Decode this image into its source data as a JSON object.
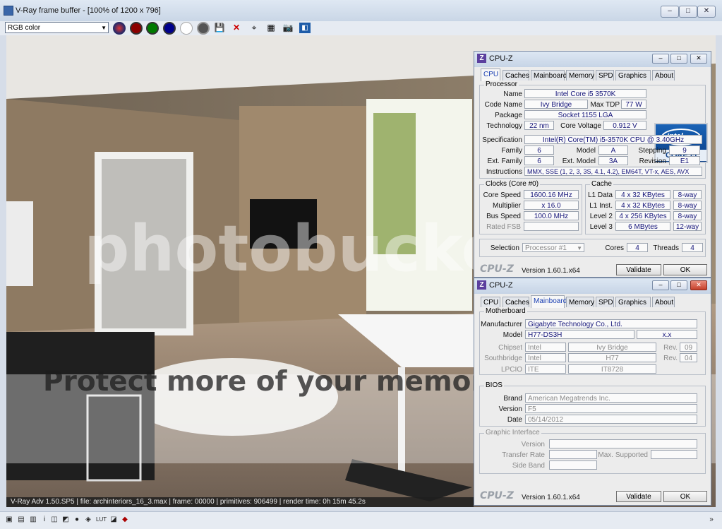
{
  "vray": {
    "title": "V-Ray frame buffer - [100% of 1200 x 796]",
    "channel": "RGB color",
    "status": "V-Ray Adv 1.50.SP5 | file: archinteriors_16_3.max | frame: 00000 | primitives: 906499 | render time: 0h 15m 45.2s",
    "watermark_top": "photobucket",
    "watermark_bottom": "Protect more of your memories for less!",
    "window_buttons": {
      "minimize": "–",
      "maximize": "□",
      "close": "✕"
    }
  },
  "cpuz1": {
    "title": "CPU-Z",
    "tabs": [
      "CPU",
      "Caches",
      "Mainboard",
      "Memory",
      "SPD",
      "Graphics",
      "About"
    ],
    "active_tab": "CPU",
    "processor": {
      "legend": "Processor",
      "name_label": "Name",
      "name": "Intel Core i5 3570K",
      "codename_label": "Code Name",
      "codename": "Ivy Bridge",
      "maxtdp_label": "Max TDP",
      "maxtdp": "77 W",
      "package_label": "Package",
      "package": "Socket 1155 LGA",
      "tech_label": "Technology",
      "tech": "22 nm",
      "voltage_label": "Core Voltage",
      "voltage": "0.912 V",
      "spec_label": "Specification",
      "spec": "Intel(R) Core(TM) i5-3570K CPU @ 3.40GHz",
      "family_label": "Family",
      "family": "6",
      "model_label": "Model",
      "model": "A",
      "stepping_label": "Stepping",
      "stepping": "9",
      "extfamily_label": "Ext. Family",
      "extfamily": "6",
      "extmodel_label": "Ext. Model",
      "extmodel": "3A",
      "revision_label": "Revision",
      "revision": "E1",
      "instr_label": "Instructions",
      "instr": "MMX, SSE (1, 2, 3, 3S, 4.1, 4.2), EM64T, VT-x, AES, AVX",
      "badge_top": "intel",
      "badge_sub": "inside",
      "badge_bottom": "CORE i5"
    },
    "clocks": {
      "legend": "Clocks (Core #0)",
      "speed_label": "Core Speed",
      "speed": "1600.16 MHz",
      "mult_label": "Multiplier",
      "mult": "x 16.0",
      "bus_label": "Bus Speed",
      "bus": "100.0 MHz",
      "fsb_label": "Rated FSB",
      "fsb": ""
    },
    "cache": {
      "legend": "Cache",
      "l1d_label": "L1 Data",
      "l1d": "4 x 32 KBytes",
      "l1d_way": "8-way",
      "l1i_label": "L1 Inst.",
      "l1i": "4 x 32 KBytes",
      "l1i_way": "8-way",
      "l2_label": "Level 2",
      "l2": "4 x 256 KBytes",
      "l2_way": "8-way",
      "l3_label": "Level 3",
      "l3": "6 MBytes",
      "l3_way": "12-way"
    },
    "selection_label": "Selection",
    "selection": "Processor #1",
    "cores_label": "Cores",
    "cores": "4",
    "threads_label": "Threads",
    "threads": "4",
    "brand": "CPU-Z",
    "version": "Version 1.60.1.x64",
    "validate": "Validate",
    "ok": "OK"
  },
  "cpuz2": {
    "title": "CPU-Z",
    "tabs": [
      "CPU",
      "Caches",
      "Mainboard",
      "Memory",
      "SPD",
      "Graphics",
      "About"
    ],
    "active_tab": "Mainboard",
    "motherboard": {
      "legend": "Motherboard",
      "manufacturer_label": "Manufacturer",
      "manufacturer": "Gigabyte Technology Co., Ltd.",
      "model_label": "Model",
      "model": "H77-DS3H",
      "model_rev": "x.x",
      "chipset_label": "Chipset",
      "chipset_vendor": "Intel",
      "chipset": "Ivy Bridge",
      "chipset_rev_label": "Rev.",
      "chipset_rev": "09",
      "south_label": "Southbridge",
      "south_vendor": "Intel",
      "south": "H77",
      "south_rev_label": "Rev.",
      "south_rev": "04",
      "lpcio_label": "LPCIO",
      "lpcio_vendor": "ITE",
      "lpcio": "IT8728"
    },
    "bios": {
      "legend": "BIOS",
      "brand_label": "Brand",
      "brand": "American Megatrends Inc.",
      "version_label": "Version",
      "version": "F5",
      "date_label": "Date",
      "date": "05/14/2012"
    },
    "graphic": {
      "legend": "Graphic Interface",
      "version_label": "Version",
      "transfer_label": "Transfer Rate",
      "maxsup_label": "Max. Supported",
      "sideband_label": "Side Band"
    },
    "brand": "CPU-Z",
    "version": "Version 1.60.1.x64",
    "validate": "Validate",
    "ok": "OK"
  }
}
